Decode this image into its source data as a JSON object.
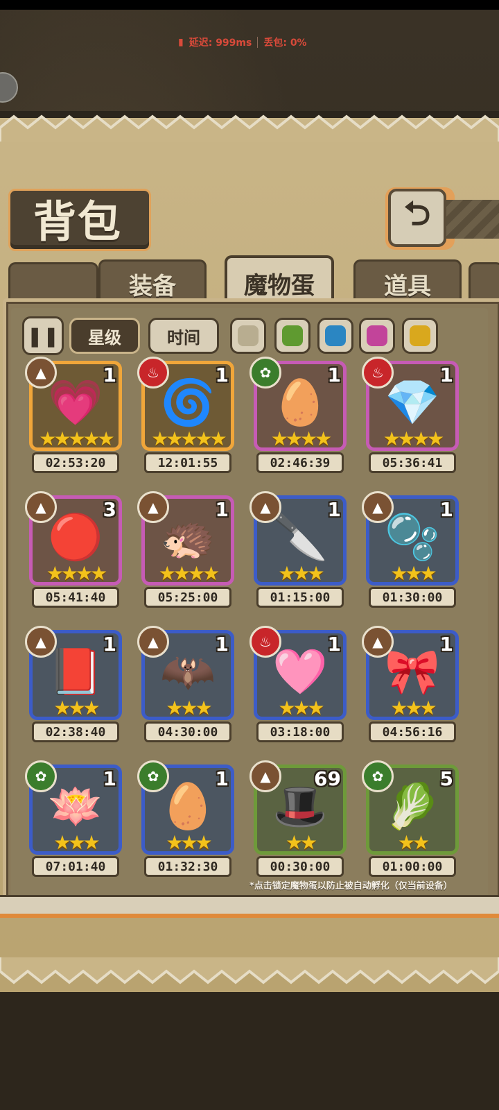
{
  "network": {
    "latency_label": "延迟: 999ms",
    "loss_label": "丢包: 0%"
  },
  "title": "背包",
  "back_icon": "return-arrow-icon",
  "tabs": [
    {
      "label": "装备",
      "active": false
    },
    {
      "label": "魔物蛋",
      "active": true
    },
    {
      "label": "道具",
      "active": false
    }
  ],
  "filters": {
    "star_label": "星级",
    "time_label": "时间",
    "colors": [
      "#b8ad90",
      "#5f9a30",
      "#2b86c2",
      "#c2449a",
      "#d9a81d"
    ]
  },
  "eggs": [
    {
      "qty": "1",
      "element": "earth",
      "rarity": "gold",
      "stars": "★★★★★",
      "timer": "02:53:20",
      "icon": "heart-egg-icon"
    },
    {
      "qty": "1",
      "element": "fire",
      "rarity": "gold",
      "stars": "★★★★★",
      "timer": "12:01:55",
      "icon": "spiral-egg-icon"
    },
    {
      "qty": "1",
      "element": "grass",
      "rarity": "purple",
      "stars": "★★★★",
      "timer": "02:46:39",
      "icon": "feather-egg-icon"
    },
    {
      "qty": "1",
      "element": "fire",
      "rarity": "purple",
      "stars": "★★★★",
      "timer": "05:36:41",
      "icon": "crystal-egg-icon"
    },
    {
      "qty": "3",
      "element": "earth",
      "rarity": "purple",
      "stars": "★★★★",
      "timer": "05:41:40",
      "icon": "thorn-egg-icon"
    },
    {
      "qty": "1",
      "element": "earth",
      "rarity": "purple",
      "stars": "★★★★",
      "timer": "05:25:00",
      "icon": "furry-egg-icon"
    },
    {
      "qty": "1",
      "element": "earth",
      "rarity": "blue",
      "stars": "★★★",
      "timer": "01:15:00",
      "icon": "cleaver-egg-icon"
    },
    {
      "qty": "1",
      "element": "earth",
      "rarity": "blue",
      "stars": "★★★",
      "timer": "01:30:00",
      "icon": "slime-egg-icon"
    },
    {
      "qty": "1",
      "element": "earth",
      "rarity": "blue",
      "stars": "★★★",
      "timer": "02:38:40",
      "icon": "book-egg-icon"
    },
    {
      "qty": "1",
      "element": "earth",
      "rarity": "blue",
      "stars": "★★★",
      "timer": "04:30:00",
      "icon": "bat-egg-icon"
    },
    {
      "qty": "1",
      "element": "fire",
      "rarity": "blue",
      "stars": "★★★",
      "timer": "03:18:00",
      "icon": "pink-egg-icon"
    },
    {
      "qty": "1",
      "element": "earth",
      "rarity": "blue",
      "stars": "★★★",
      "timer": "04:56:16",
      "icon": "bow-egg-icon"
    },
    {
      "qty": "1",
      "element": "grass",
      "rarity": "blue",
      "stars": "★★★",
      "timer": "07:01:40",
      "icon": "lotus-egg-icon"
    },
    {
      "qty": "1",
      "element": "grass",
      "rarity": "blue",
      "stars": "★★★",
      "timer": "01:32:30",
      "icon": "pearl-egg-icon"
    },
    {
      "qty": "69",
      "element": "earth",
      "rarity": "green",
      "stars": "★★",
      "timer": "00:30:00",
      "icon": "hat-egg-icon"
    },
    {
      "qty": "5",
      "element": "grass",
      "rarity": "green",
      "stars": "★★",
      "timer": "01:00:00",
      "icon": "turnip-egg-icon"
    }
  ],
  "footer_note": "*点击锁定魔物蛋以防止被自动孵化（仅当前设备）"
}
